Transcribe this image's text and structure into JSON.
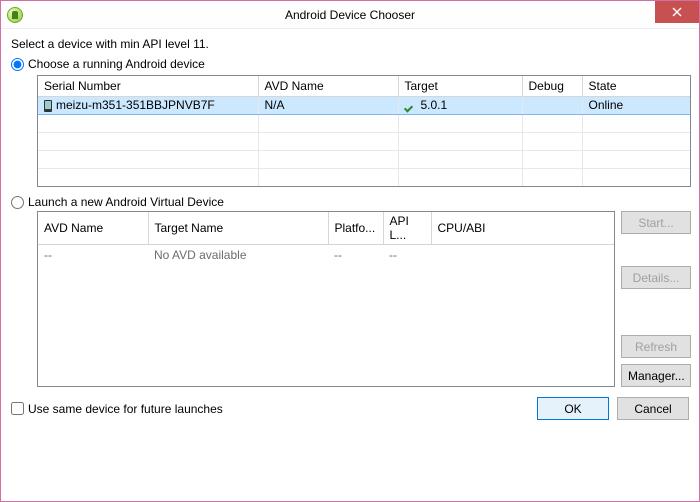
{
  "window": {
    "title": "Android Device Chooser"
  },
  "instruction": "Select a device with min API level 11.",
  "options": {
    "choose_running": "Choose a running Android device",
    "launch_new": "Launch a new Android Virtual Device"
  },
  "running_table": {
    "headers": {
      "serial": "Serial Number",
      "avd": "AVD Name",
      "target": "Target",
      "debug": "Debug",
      "state": "State"
    },
    "rows": [
      {
        "serial": "meizu-m351-351BBJPNVB7F",
        "avd": "N/A",
        "target": "5.0.1",
        "debug": "",
        "state": "Online",
        "selected": true,
        "target_ok": true
      }
    ]
  },
  "avd_table": {
    "headers": {
      "name": "AVD Name",
      "target": "Target Name",
      "platform": "Platfo...",
      "api": "API L...",
      "cpu": "CPU/ABI"
    },
    "empty_row": {
      "name": "--",
      "target": "No AVD available",
      "platform": "--",
      "api": "--",
      "cpu": ""
    }
  },
  "side_buttons": {
    "start": "Start...",
    "details": "Details...",
    "refresh": "Refresh",
    "manager": "Manager..."
  },
  "footer": {
    "checkbox_label": "Use same device for future launches",
    "ok": "OK",
    "cancel": "Cancel"
  }
}
